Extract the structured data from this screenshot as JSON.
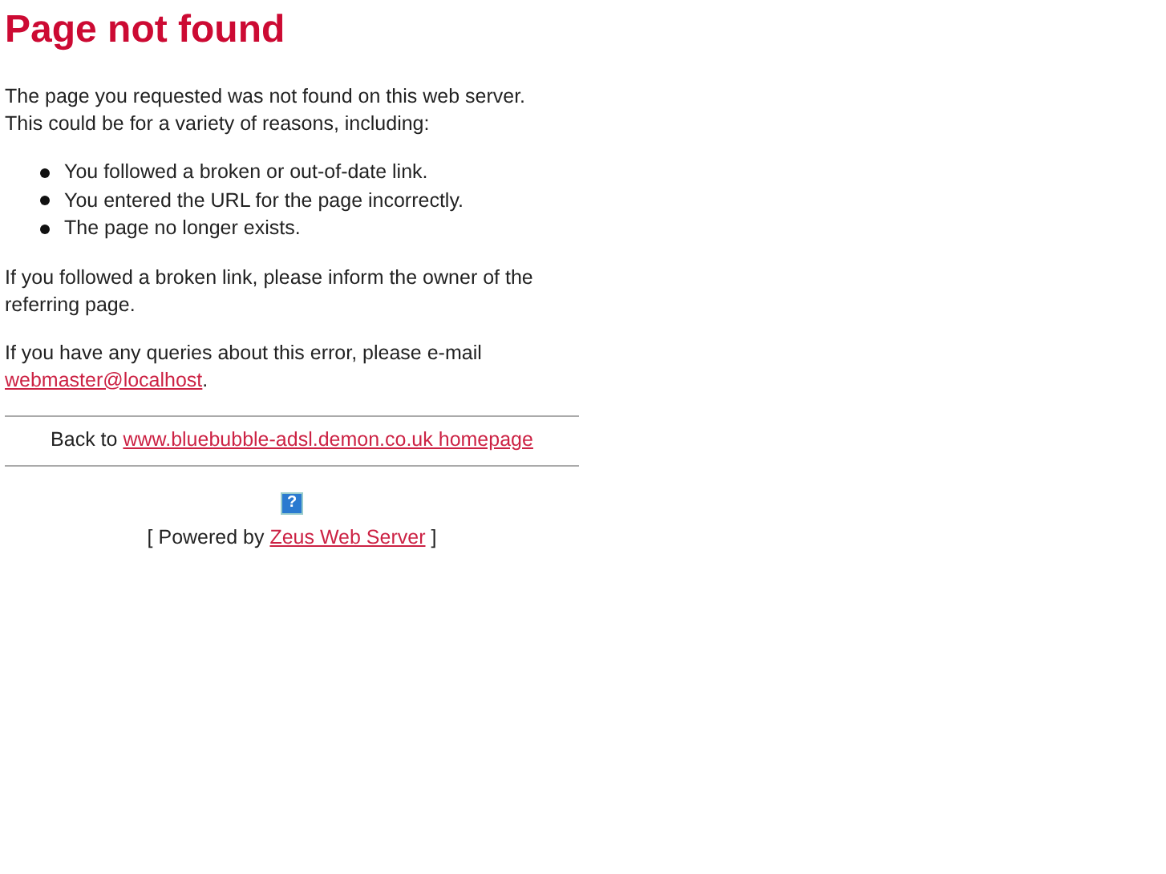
{
  "title": "Page not found",
  "intro": [
    "The page you requested was not found on this web server.",
    "This could be for a variety of reasons, including:"
  ],
  "reasons": [
    "You followed a broken or out-of-date link.",
    "You entered the URL for the page incorrectly.",
    "The page no longer exists."
  ],
  "broken_link_note": "If you followed a broken link, please inform the owner of the referring page.",
  "contact": {
    "text": "If you have any queries about this error, please e-mail",
    "link": "webmaster@localhost",
    "after": "."
  },
  "back": {
    "text": "Back to",
    "link": "www.bluebubble-adsl.demon.co.uk homepage"
  },
  "footer": {
    "icon": "?",
    "before": "[ Powered by",
    "link": "Zeus Web Server",
    "after": "]"
  }
}
